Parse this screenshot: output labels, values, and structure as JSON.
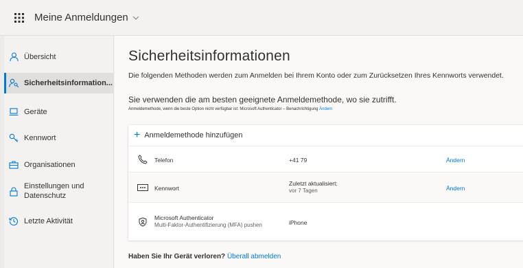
{
  "app": {
    "title": "Meine Anmeldungen",
    "waffle_icon": "app-launcher-icon",
    "chevron_icon": "chevron-down-icon"
  },
  "sidebar": {
    "items": [
      {
        "label": "Übersicht",
        "icon": "person-icon",
        "active": false
      },
      {
        "label": "Sicherheitsinformation...",
        "icon": "key-person-icon",
        "active": true
      },
      {
        "label": "Geräte",
        "icon": "laptop-icon",
        "active": false
      },
      {
        "label": "Kennwort",
        "icon": "key-icon",
        "active": false
      },
      {
        "label": "Organisationen",
        "icon": "briefcase-icon",
        "active": false
      },
      {
        "label": "Einstellungen und Datenschutz",
        "icon": "lock-icon",
        "active": false
      },
      {
        "label": "Letzte Aktivität",
        "icon": "history-icon",
        "active": false
      }
    ]
  },
  "main": {
    "title": "Sicherheitsinformationen",
    "subtitle": "Die folgenden Methoden werden zum Anmelden bei Ihrem Konto oder zum Zurücksetzen Ihres Kennworts verwendet.",
    "best_method_text": "Sie verwenden die am besten geeignete Anmeldemethode, wo sie zutrifft.",
    "default_method_text": "Anmeldemethode, wenn die beste Option nicht verfügbar ist: Microsoft Authenticator – Benachrichtigung",
    "default_method_link": "Ändern",
    "add_method_label": "Anmeldemethode hinzufügen",
    "methods": [
      {
        "icon": "phone-icon",
        "name": "Telefon",
        "detail": "+41 79",
        "action": "Ändern"
      },
      {
        "icon": "password-icon",
        "name": "Kennwort",
        "detail": "Zuletzt aktualisiert:",
        "detail_sub": "vor 7 Tagen",
        "action": "Ändern"
      },
      {
        "icon": "authenticator-icon",
        "name": "Microsoft Authenticator",
        "name_sub": "Multi-Faktor-Authentifizierung (MFA) pushen",
        "detail": "iPhone"
      }
    ],
    "lost_device_text": "Haben Sie Ihr Gerät verloren?",
    "lost_device_link": "Überall abmelden"
  },
  "colors": {
    "accent": "#0078d4",
    "text": "#323130",
    "background": "#faf9f8"
  }
}
